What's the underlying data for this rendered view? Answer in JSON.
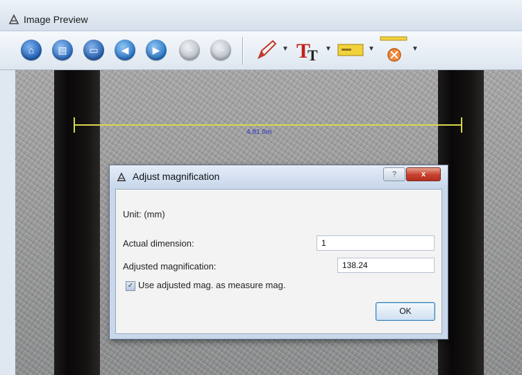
{
  "window": {
    "title": "Image Preview",
    "title_icon": "app-triangle-icon"
  },
  "toolbar": {
    "buttons": [
      {
        "icon": "home-icon",
        "color": "#1f5fb5"
      },
      {
        "icon": "document-icon",
        "color": "#2c6cbf"
      },
      {
        "icon": "print-icon",
        "color": "#245fae"
      },
      {
        "icon": "back-arrow-icon",
        "color": "#2a74c4"
      },
      {
        "icon": "forward-arrow-icon",
        "color": "#2a74c4"
      },
      {
        "icon": "minus-disabled-icon",
        "color": "#b9bec6"
      },
      {
        "icon": "minus-disabled-icon",
        "color": "#b9bec6"
      }
    ],
    "tools": [
      {
        "icon": "pencil-icon"
      },
      {
        "icon": "text-tool-icon",
        "glyph": "T"
      },
      {
        "icon": "label-box-icon"
      },
      {
        "icon": "measure-clear-icon"
      }
    ]
  },
  "image": {
    "measurement_label": "4.91 0m",
    "measure_color": "#d7d84a"
  },
  "dialog": {
    "title": "Adjust magnification",
    "help_label": "?",
    "close_label": "x",
    "unit_text": "Unit: (mm)",
    "actual_dimension_label": "Actual dimension:",
    "actual_dimension_value": "1",
    "adjusted_magnification_label": "Adjusted magnification:",
    "adjusted_magnification_value": "138.24",
    "checkbox_label": "Use adjusted mag. as measure mag.",
    "checkbox_checked": true,
    "ok_label": "OK"
  }
}
